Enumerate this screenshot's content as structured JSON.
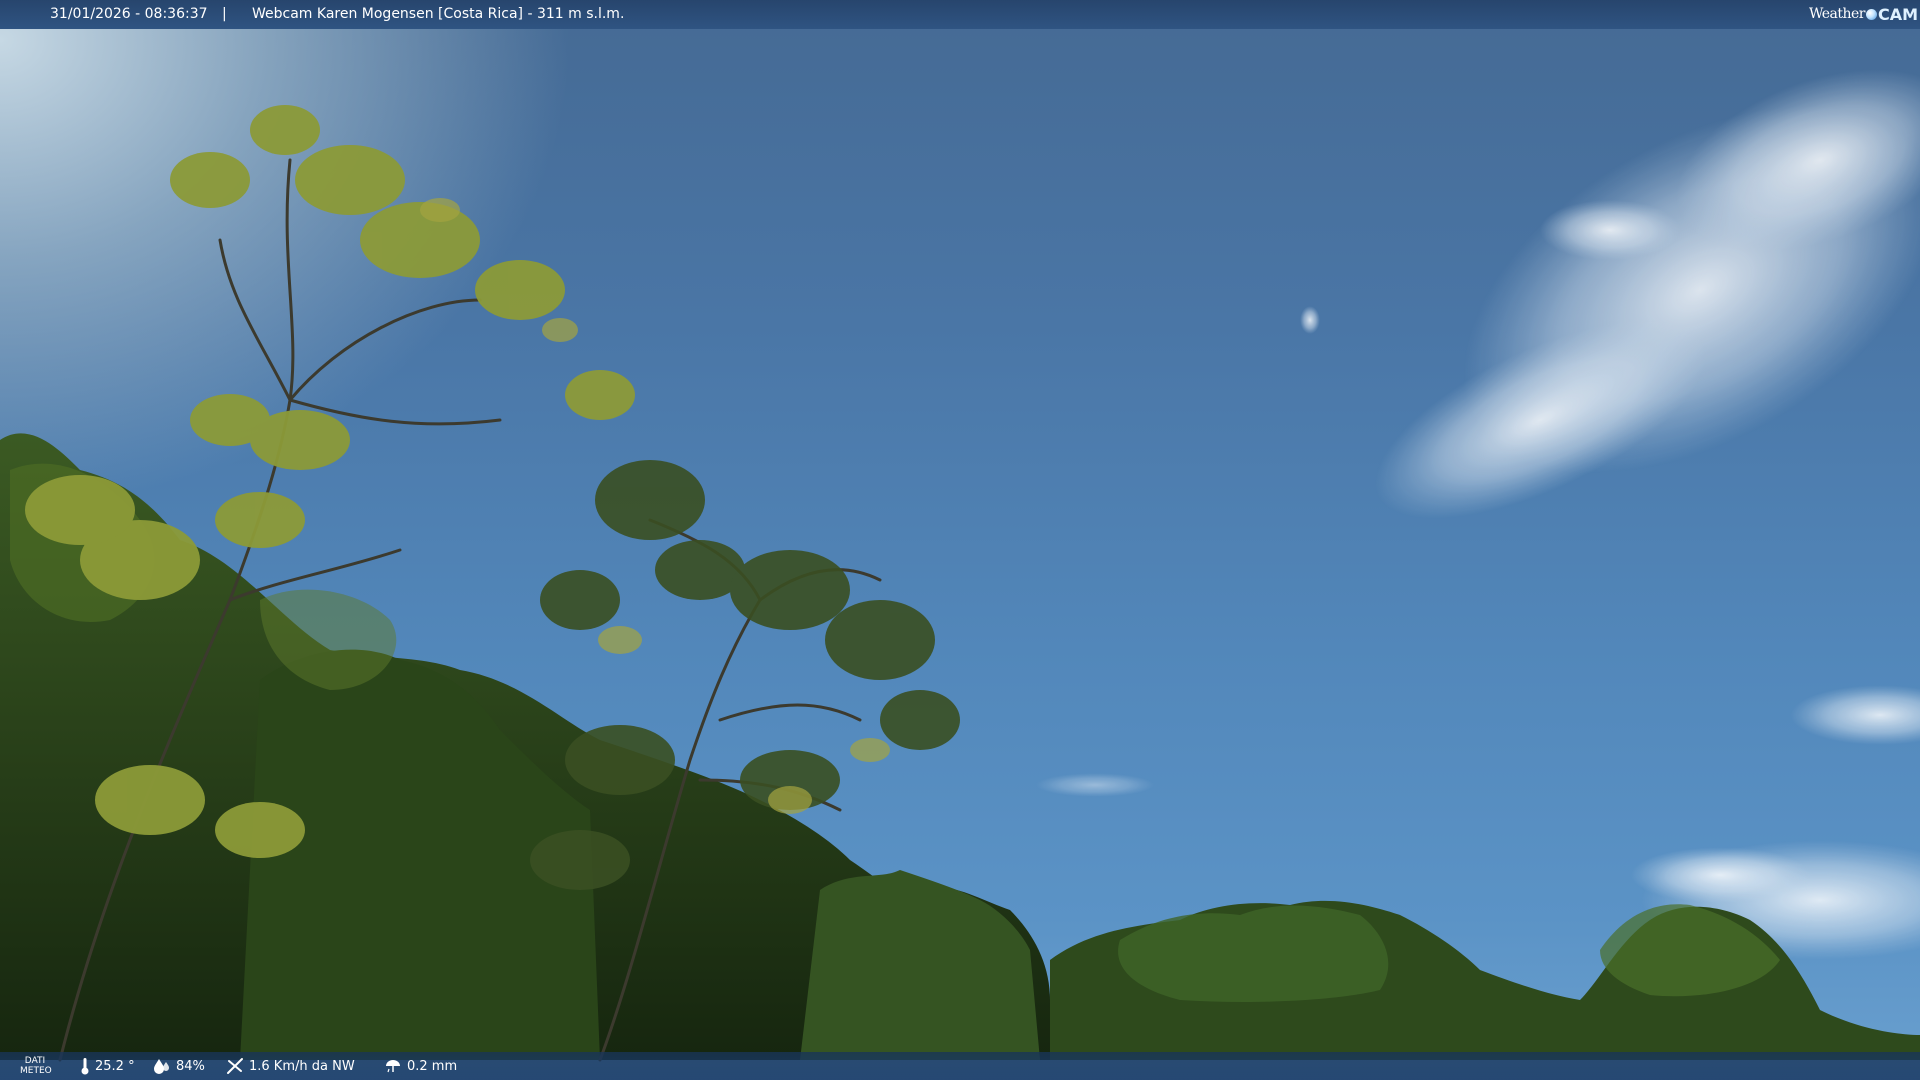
{
  "header": {
    "timestamp": "31/01/2026 - 08:36:37",
    "separator": "|",
    "title": "Webcam Karen Mogensen [Costa Rica] - 311 m s.l.m."
  },
  "logo": {
    "weather": "Weather",
    "cam": "CAM"
  },
  "weather_bar": {
    "label_line1": "DATI",
    "label_line2": "METEO",
    "temperature": "25.2 °",
    "humidity": "84%",
    "wind": "1.6 Km/h da NW",
    "rain": "0.2 mm",
    "icons": {
      "temperature": "thermometer-icon",
      "humidity": "humidity-drop-icon",
      "wind": "wind-icon",
      "rain": "rain-icon"
    }
  },
  "colors": {
    "bar_background": "#2b4d78",
    "sky_top": "#456a94",
    "sky_bottom": "#6aa0cf",
    "foliage_dark": "#1f3518",
    "foliage_light": "#8a9a36"
  }
}
